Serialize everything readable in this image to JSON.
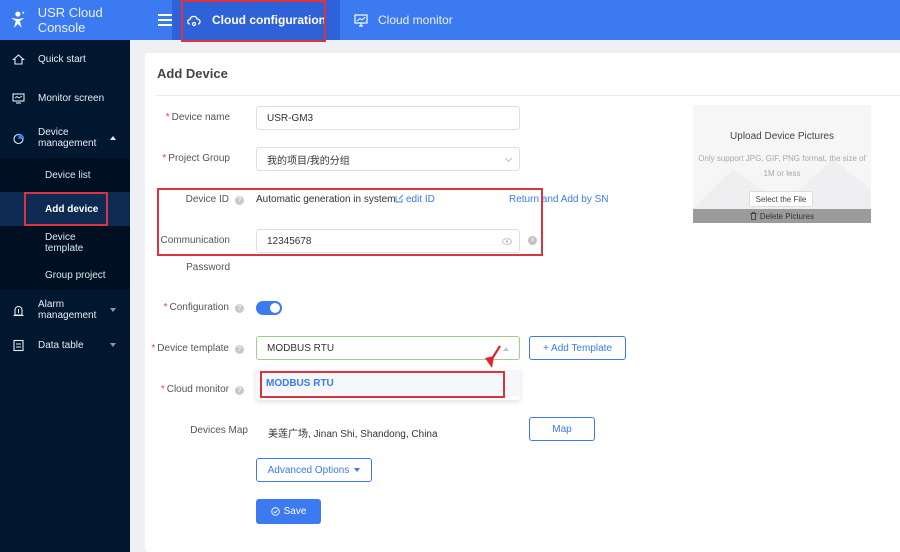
{
  "header": {
    "app_title": "USR Cloud Console",
    "tabs": [
      {
        "label": "Cloud configuration",
        "icon": "cloud-icon",
        "active": true
      },
      {
        "label": "Cloud monitor",
        "icon": "monitor-icon",
        "active": false
      }
    ]
  },
  "sidebar": {
    "items": [
      {
        "label": "Quick start",
        "icon": "home-icon"
      },
      {
        "label": "Monitor screen",
        "icon": "monitor-screen-icon"
      },
      {
        "label": "Device management",
        "icon": "pie-chart-icon",
        "expanded": true,
        "children": [
          {
            "label": "Device list"
          },
          {
            "label": "Add device",
            "active": true
          },
          {
            "label": "Device template"
          },
          {
            "label": "Group project"
          }
        ]
      },
      {
        "label": "Alarm management",
        "icon": "alarm-icon",
        "expanded": false
      },
      {
        "label": "Data table",
        "icon": "table-icon",
        "expanded": false
      }
    ]
  },
  "form": {
    "title": "Add Device",
    "device_name": {
      "label": "Device name",
      "required": true,
      "value": "USR-GM3"
    },
    "project_group": {
      "label": "Project Group",
      "required": true,
      "value": "我的项目/我的分组"
    },
    "device_id": {
      "label": "Device ID",
      "value": "Automatic generation in system",
      "edit_link": "edit ID",
      "return_link": "Return and Add by SN"
    },
    "comm_password": {
      "label_line1": "Communication",
      "label_line2": "Password",
      "value": "12345678"
    },
    "configuration": {
      "label": "Configuration",
      "required": true,
      "enabled": true
    },
    "device_template": {
      "label": "Device template",
      "required": true,
      "value": "MODBUS RTU",
      "add_button": "+ Add Template",
      "options": [
        "MODBUS RTU"
      ]
    },
    "cloud_monitor": {
      "label": "Cloud monitor",
      "required": true
    },
    "devices_map": {
      "label": "Devices Map",
      "value": "美莲广场, Jinan Shi, Shandong, China",
      "button": "Map"
    },
    "advanced_options": "Advanced Options",
    "save": "Save"
  },
  "upload": {
    "title": "Upload Device Pictures",
    "hint": "Only support JPG, GIF, PNG format, the size of 1M or less",
    "select_button": "Select the File",
    "delete_button": "Delete Pictures"
  },
  "colors": {
    "primary": "#3b7af0",
    "sidebar_bg": "#001730",
    "highlight_border": "#d9343f"
  }
}
